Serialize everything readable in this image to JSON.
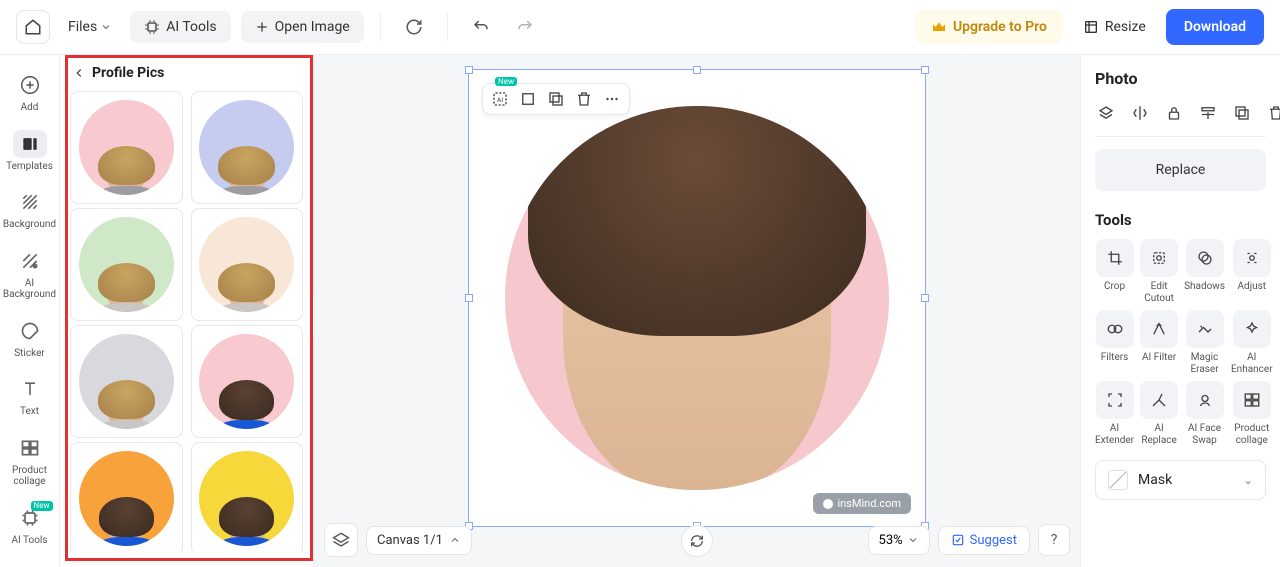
{
  "topbar": {
    "files_label": "Files",
    "ai_tools_label": "AI Tools",
    "open_image_label": "Open Image",
    "upgrade_label": "Upgrade to Pro",
    "resize_label": "Resize",
    "download_label": "Download"
  },
  "rail": {
    "items": [
      {
        "label": "Add"
      },
      {
        "label": "Templates"
      },
      {
        "label": "Background"
      },
      {
        "label": "AI\nBackground"
      },
      {
        "label": "Sticker"
      },
      {
        "label": "Text"
      },
      {
        "label": "Product\ncollage"
      },
      {
        "label": "AI Tools"
      }
    ],
    "new_badge": "New"
  },
  "panel": {
    "title": "Profile Pics",
    "templates": [
      {
        "bg": "pink",
        "hair": "blonde",
        "torso": "#9c9ca2"
      },
      {
        "bg": "lavender",
        "hair": "blonde",
        "torso": "#9c9ca2"
      },
      {
        "bg": "green",
        "hair": "blonde",
        "torso": "#c8c7c5"
      },
      {
        "bg": "cream",
        "hair": "blonde",
        "torso": "#c8c7c5"
      },
      {
        "bg": "grey",
        "hair": "blonde",
        "torso": "#c8c7c5"
      },
      {
        "bg": "pink",
        "hair": "dark",
        "torso": "#1857d6"
      },
      {
        "bg": "orange",
        "hair": "dark",
        "torso": "#1857d6"
      },
      {
        "bg": "yellow",
        "hair": "dark",
        "torso": "#1857d6"
      }
    ]
  },
  "canvas": {
    "pager_label": "Canvas 1/1",
    "zoom_label": "53%",
    "suggest_label": "Suggest",
    "help_label": "?",
    "watermark": "insMind.com",
    "floatbar_new": "New"
  },
  "rpanel": {
    "photo_heading": "Photo",
    "replace_label": "Replace",
    "tools_heading": "Tools",
    "tools": [
      {
        "label": "Crop"
      },
      {
        "label": "Edit\nCutout"
      },
      {
        "label": "Shadows"
      },
      {
        "label": "Adjust"
      },
      {
        "label": "Filters"
      },
      {
        "label": "AI Filter"
      },
      {
        "label": "Magic\nEraser"
      },
      {
        "label": "AI\nEnhancer"
      },
      {
        "label": "AI\nExtender"
      },
      {
        "label": "AI\nReplace"
      },
      {
        "label": "AI Face\nSwap"
      },
      {
        "label": "Product\ncollage"
      }
    ],
    "mask_label": "Mask"
  }
}
